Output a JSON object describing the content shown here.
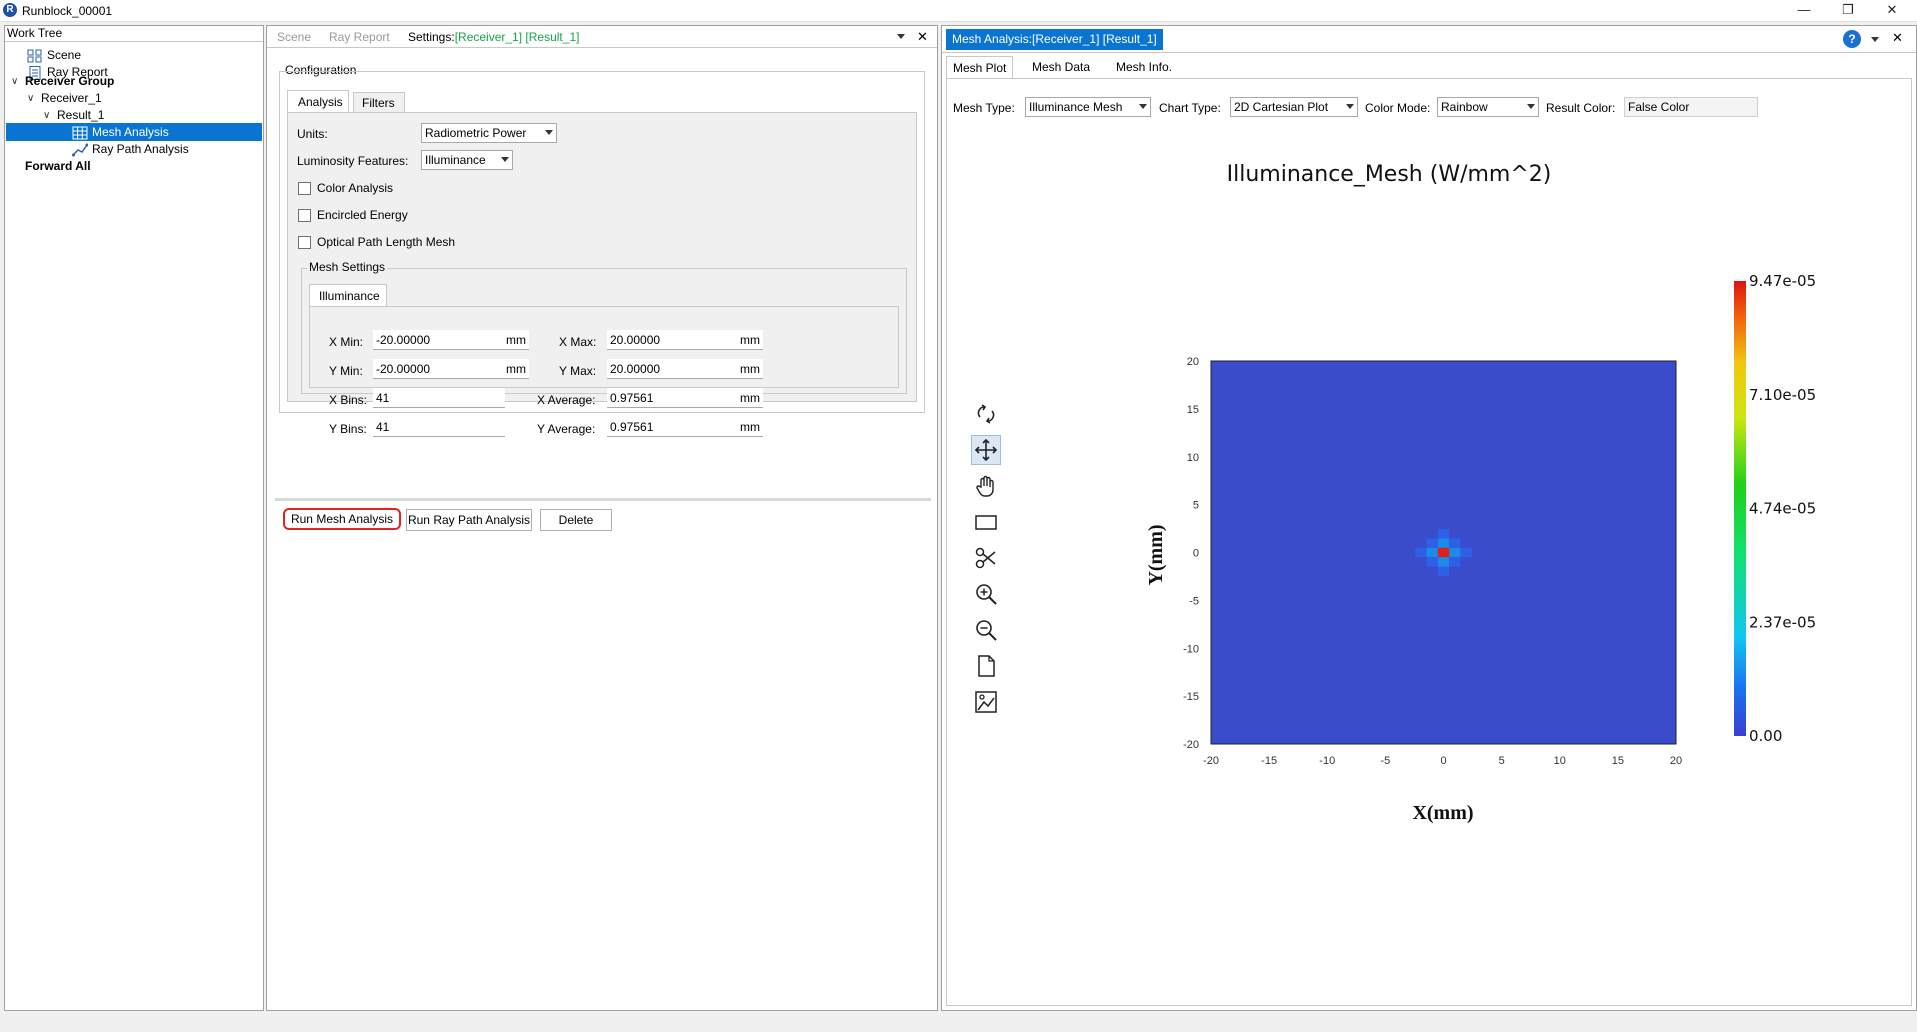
{
  "window": {
    "title": "Runblock_00001",
    "logo_letter": "R"
  },
  "worktree": {
    "header": "Work Tree",
    "items": [
      {
        "label": "Scene"
      },
      {
        "label": "Ray Report"
      },
      {
        "label": "Receiver Group"
      },
      {
        "label": "Receiver_1"
      },
      {
        "label": "Result_1"
      },
      {
        "label": "Mesh Analysis"
      },
      {
        "label": "Ray Path Analysis"
      },
      {
        "label": "Forward All"
      }
    ]
  },
  "settings": {
    "tabs": {
      "scene": "Scene",
      "ray_report": "Ray Report",
      "settings_prefix": "Settings:",
      "receiver": "[Receiver_1]",
      "result": "[Result_1]"
    },
    "configuration": "Configuration",
    "subtabs": {
      "analysis": "Analysis",
      "filters": "Filters"
    },
    "units_label": "Units:",
    "units_value": "Radiometric Power",
    "luminosity_label": "Luminosity Features:",
    "luminosity_value": "Illuminance",
    "checkboxes": [
      "Color Analysis",
      "Encircled Energy",
      "Optical Path Length Mesh"
    ],
    "mesh_settings": "Mesh Settings",
    "illuminance_tab": "Illuminance",
    "xmin_label": "X Min:",
    "xmin_value": "-20.00000",
    "xmin_unit": "mm",
    "xmax_label": "X Max:",
    "xmax_value": "20.00000",
    "xmax_unit": "mm",
    "ymin_label": "Y Min:",
    "ymin_value": "-20.00000",
    "ymin_unit": "mm",
    "ymax_label": "Y Max:",
    "ymax_value": "20.00000",
    "ymax_unit": "mm",
    "xbins_label": "X Bins:",
    "xbins_value": "41",
    "xavg_label": "X Average:",
    "xavg_value": "0.97561",
    "xavg_unit": "mm",
    "ybins_label": "Y Bins:",
    "ybins_value": "41",
    "yavg_label": "Y Average:",
    "yavg_value": "0.97561",
    "yavg_unit": "mm",
    "buttons": {
      "run_mesh": "Run Mesh Analysis",
      "run_ray": "Run Ray Path Analysis",
      "delete": "Delete"
    }
  },
  "mesh": {
    "tab_title": "Mesh Analysis:[Receiver_1] [Result_1]",
    "subtabs": {
      "plot": "Mesh Plot",
      "data": "Mesh Data",
      "info": "Mesh Info."
    },
    "mesh_type_label": "Mesh Type:",
    "mesh_type_value": "Illuminance Mesh",
    "chart_type_label": "Chart Type:",
    "chart_type_value": "2D Cartesian Plot",
    "color_mode_label": "Color Mode:",
    "color_mode_value": "Rainbow",
    "result_color_label": "Result Color:",
    "result_color_value": "False Color",
    "tools": [
      "rotate-icon",
      "move-icon",
      "pan-hand-icon",
      "rectangle-select-icon",
      "scissors-icon",
      "zoom-in-icon",
      "zoom-out-icon",
      "page-icon",
      "image-export-icon"
    ]
  },
  "chart_data": {
    "type": "heatmap",
    "title": "Illuminance_Mesh (W/mm^2)",
    "xlabel": "X(mm)",
    "ylabel": "Y(mm)",
    "xlim": [
      -20,
      20
    ],
    "ylim": [
      -20,
      20
    ],
    "xticks": [
      -20,
      -15,
      -10,
      -5,
      0,
      5,
      10,
      15,
      20
    ],
    "yticks": [
      20,
      15,
      10,
      5,
      0,
      -5,
      -10,
      -15,
      -20
    ],
    "colorbar_labels": [
      "9.47e-05",
      "7.10e-05",
      "4.74e-05",
      "2.37e-05",
      "0.00"
    ],
    "colorbar_range": [
      0,
      9.47e-05
    ],
    "background_value": 0,
    "hotspot": [
      {
        "x": 0,
        "y": 0,
        "value": 9.47e-05
      },
      {
        "x": -0.976,
        "y": 0,
        "value": 2.6e-05
      },
      {
        "x": 0.976,
        "y": 0,
        "value": 2.6e-05
      },
      {
        "x": 0,
        "y": 0.976,
        "value": 2.6e-05
      },
      {
        "x": 0,
        "y": -0.976,
        "value": 2.6e-05
      },
      {
        "x": -0.976,
        "y": 0.976,
        "value": 1.2e-05
      },
      {
        "x": 0.976,
        "y": 0.976,
        "value": 1.2e-05
      },
      {
        "x": -0.976,
        "y": -0.976,
        "value": 1.2e-05
      },
      {
        "x": 0.976,
        "y": -0.976,
        "value": 1.2e-05
      },
      {
        "x": -1.95,
        "y": 0,
        "value": 8e-06
      },
      {
        "x": 1.95,
        "y": 0,
        "value": 8e-06
      },
      {
        "x": 0,
        "y": 1.95,
        "value": 8e-06
      },
      {
        "x": 0,
        "y": -1.95,
        "value": 8e-06
      }
    ],
    "colors": [
      "#3a4cc9",
      "#2e5fe8",
      "#1b8be6",
      "#e11d1d"
    ]
  }
}
